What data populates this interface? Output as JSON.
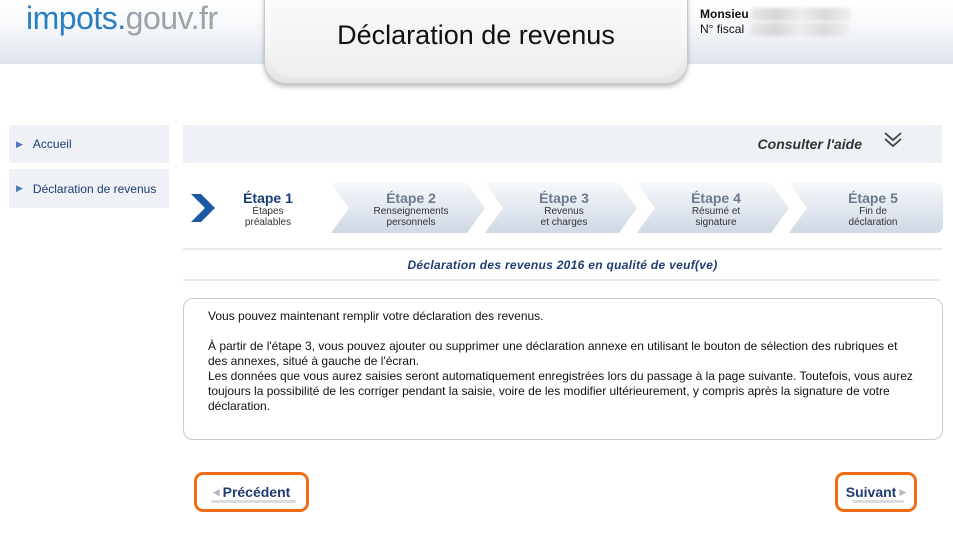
{
  "header": {
    "logo_part1": "impots.",
    "logo_part2": "gouv.fr",
    "title": "Déclaration de revenus",
    "user_name_label": "Monsieu",
    "fiscal_label": "N° fiscal"
  },
  "sidebar": {
    "items": [
      {
        "label": "Accueil"
      },
      {
        "label": "Déclaration de revenus"
      }
    ]
  },
  "help": {
    "label": "Consulter l'aide"
  },
  "steps": [
    {
      "title": "Étape 1",
      "sub1": "Étapes",
      "sub2": "préalables",
      "active": true
    },
    {
      "title": "Étape 2",
      "sub1": "Renseignements",
      "sub2": "personnels",
      "active": false
    },
    {
      "title": "Étape 3",
      "sub1": "Revenus",
      "sub2": "et charges",
      "active": false
    },
    {
      "title": "Étape 4",
      "sub1": "Résumé et",
      "sub2": "signature",
      "active": false
    },
    {
      "title": "Étape 5",
      "sub1": "Fin de",
      "sub2": "déclaration",
      "active": false
    }
  ],
  "declaration_title": "Déclaration des revenus 2016 en qualité de veuf(ve)",
  "info": {
    "p1": "Vous pouvez maintenant remplir votre déclaration des revenus.",
    "p2": "À partir de l'étape 3, vous pouvez ajouter ou supprimer une déclaration annexe en utilisant le bouton de sélection des rubriques et des annexes, situé à gauche de l'écran.",
    "p3": "Les données que vous aurez saisies seront automatiquement enregistrées lors du passage à la page suivante. Toutefois, vous aurez toujours la possibilité de les corriger pendant la saisie, voire de les modifier ultérieurement, y compris après la signature de votre déclaration."
  },
  "nav": {
    "prev_label": "Précédent",
    "next_label": "Suivant"
  },
  "colors": {
    "brand_blue": "#2a7fc1",
    "navy": "#1f3d73",
    "highlight_orange": "#ef6c14",
    "panel_bg": "#eef1f5"
  }
}
